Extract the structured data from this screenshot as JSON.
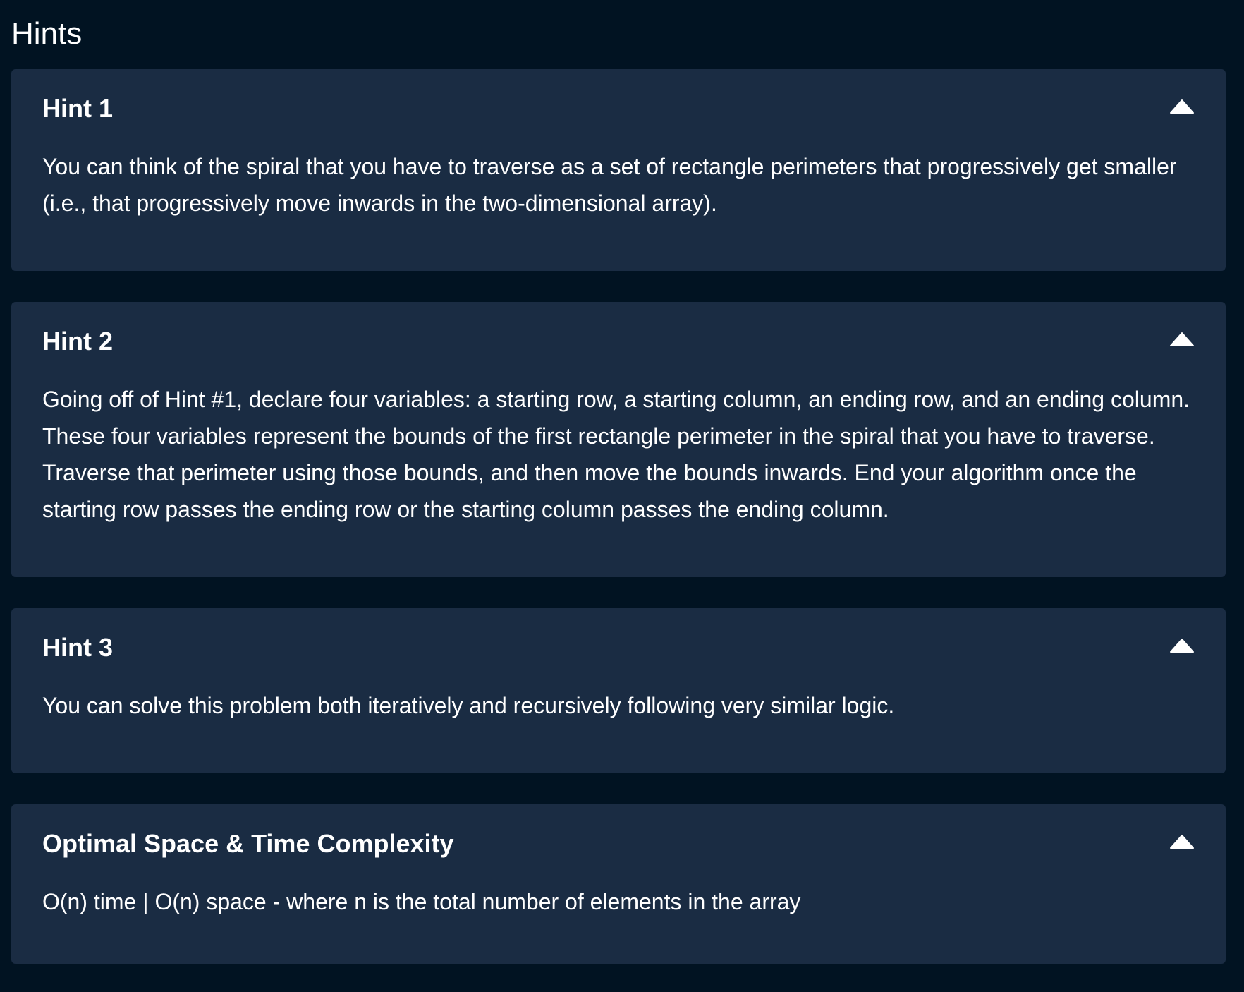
{
  "title": "Hints",
  "panels": [
    {
      "title": "Hint 1",
      "body": "You can think of the spiral that you have to traverse as a set of rectangle perimeters that progressively get smaller (i.e., that progressively move inwards in the two-dimensional array).",
      "icon": "chevron-up-icon",
      "expanded": true
    },
    {
      "title": "Hint 2",
      "body": "Going off of Hint #1, declare four variables: a starting row, a starting column, an ending row, and an ending column. These four variables represent the bounds of the first rectangle perimeter in the spiral that you have to traverse. Traverse that perimeter using those bounds, and then move the bounds inwards. End your algorithm once the starting row passes the ending row or the starting column passes the ending column.",
      "icon": "chevron-up-icon",
      "expanded": true
    },
    {
      "title": "Hint 3",
      "body": "You can solve this problem both iteratively and recursively following very similar logic.",
      "icon": "chevron-up-icon",
      "expanded": true
    },
    {
      "title": "Optimal Space & Time Complexity",
      "body": "O(n) time | O(n) space - where n is the total number of elements in the array",
      "icon": "chevron-up-icon",
      "expanded": true
    }
  ],
  "colors": {
    "background": "#011322",
    "panel": "#1a2c43",
    "text": "#ffffff"
  }
}
